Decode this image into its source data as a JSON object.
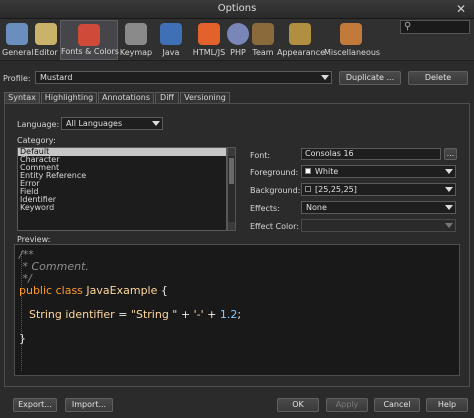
{
  "window": {
    "title": "Options",
    "close_glyph": "✕"
  },
  "toolbar": {
    "items": [
      {
        "label": "General",
        "icon": "general-icon",
        "color": "#6a8fbf"
      },
      {
        "label": "Editor",
        "icon": "editor-icon",
        "color": "#c9b36a"
      },
      {
        "label": "Fonts & Colors",
        "icon": "fonts-colors-icon",
        "color": "#d04a3a",
        "active": true
      },
      {
        "label": "Keymap",
        "icon": "keymap-icon",
        "color": "#8a8a8a"
      },
      {
        "label": "Java",
        "icon": "java-icon",
        "color": "#3f6fb5"
      },
      {
        "label": "HTML/JS",
        "icon": "html5-icon",
        "color": "#e3622c"
      },
      {
        "label": "PHP",
        "icon": "php-icon",
        "color": "#7a86b8"
      },
      {
        "label": "Team",
        "icon": "team-icon",
        "color": "#8a6a3a"
      },
      {
        "label": "Appearance",
        "icon": "appearance-icon",
        "color": "#b09040"
      },
      {
        "label": "Miscellaneous",
        "icon": "miscellaneous-icon",
        "color": "#c27a3a"
      }
    ],
    "search_placeholder": ""
  },
  "profile": {
    "label": "Profile:",
    "value": "Mustard",
    "duplicate_label": "Duplicate ...",
    "delete_label": "Delete"
  },
  "tabs": [
    "Syntax",
    "Highlighting",
    "Annotations",
    "Diff",
    "Versioning"
  ],
  "syntax": {
    "language_label": "Language:",
    "language_value": "All Languages",
    "category_label": "Category:",
    "categories": [
      "Default",
      "Character",
      "Comment",
      "Entity Reference",
      "Error",
      "Field",
      "Identifier",
      "Keyword"
    ],
    "selected_category": "Default",
    "font_label": "Font:",
    "font_value": "Consolas 16",
    "font_browse": "...",
    "foreground_label": "Foreground:",
    "foreground_value": "White",
    "foreground_color": "#ffffff",
    "background_label": "Background:",
    "background_value": "[25,25,25]",
    "background_color": "#191919",
    "effects_label": "Effects:",
    "effects_value": "None",
    "effect_color_label": "Effect Color:",
    "effect_color_value": "",
    "preview_label": "Preview:"
  },
  "preview": {
    "comment_open": "/**",
    "comment_body": " * Comment.",
    "comment_close": " */",
    "kw_public": "public",
    "kw_class": "class",
    "class_name": "JavaExample",
    "brace_open": "{",
    "type_name": "String",
    "ident": "identifier",
    "assign": "=",
    "string_lit": "\"String \"",
    "plus1": "+",
    "char_lit": "'-'",
    "plus2": "+",
    "number": "1.2",
    "semicolon": ";",
    "brace_close": "}"
  },
  "footer": {
    "export_label": "Export...",
    "import_label": "Import...",
    "ok_label": "OK",
    "apply_label": "Apply",
    "cancel_label": "Cancel",
    "help_label": "Help"
  }
}
